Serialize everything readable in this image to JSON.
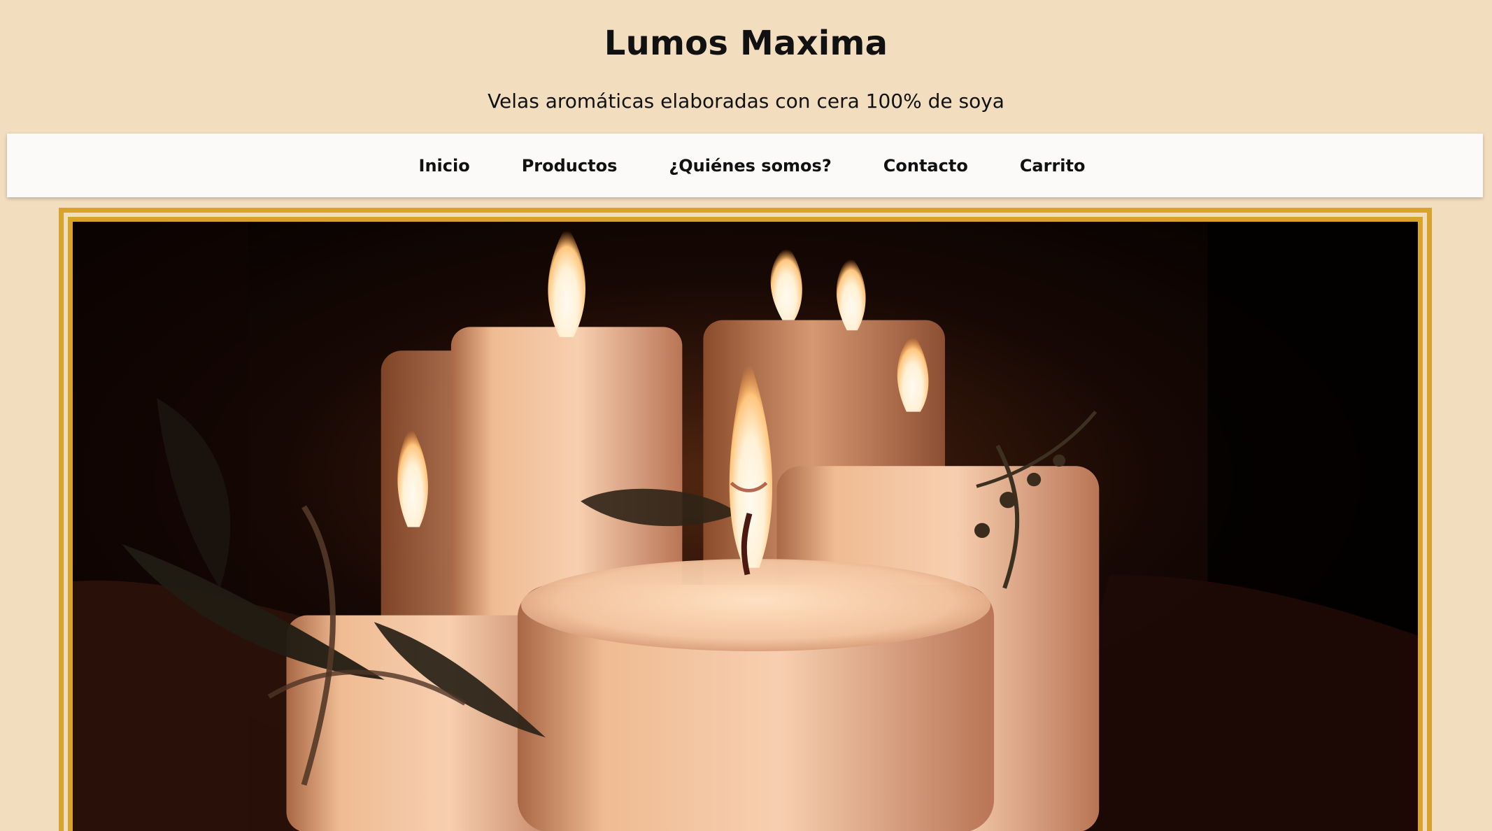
{
  "header": {
    "title": "Lumos Maxima",
    "subtitle": "Velas aromáticas elaboradas con cera 100% de soya"
  },
  "nav": {
    "items": [
      {
        "label": "Inicio"
      },
      {
        "label": "Productos"
      },
      {
        "label": "¿Quiénes somos?"
      },
      {
        "label": "Contacto"
      },
      {
        "label": "Carrito"
      }
    ]
  },
  "colors": {
    "page_background": "#f2ddbf",
    "nav_background": "#fbfaf8",
    "frame_gold": "#d8a32d"
  }
}
